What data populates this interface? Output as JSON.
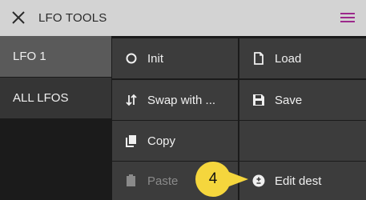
{
  "header": {
    "title": "LFO TOOLS",
    "close_icon": "close-icon",
    "menu_icon": "hamburger-menu-icon",
    "menu_color": "#9c2a8c"
  },
  "sidebar": {
    "items": [
      {
        "label": "LFO 1",
        "selected": true
      },
      {
        "label": "ALL LFOS",
        "selected": false
      }
    ]
  },
  "actions": {
    "init": {
      "label": "Init",
      "icon": "circle-icon"
    },
    "load": {
      "label": "Load",
      "icon": "file-icon"
    },
    "swap": {
      "label": "Swap with ...",
      "icon": "swap-icon"
    },
    "save": {
      "label": "Save",
      "icon": "floppy-disk-icon"
    },
    "copy": {
      "label": "Copy",
      "icon": "copy-icon"
    },
    "paste": {
      "label": "Paste",
      "icon": "paste-icon",
      "disabled": true
    },
    "edit_dest": {
      "label": "Edit dest",
      "icon": "plus-minus-circle-icon"
    }
  },
  "callout": {
    "number": "4",
    "color": "#f5d63d"
  }
}
